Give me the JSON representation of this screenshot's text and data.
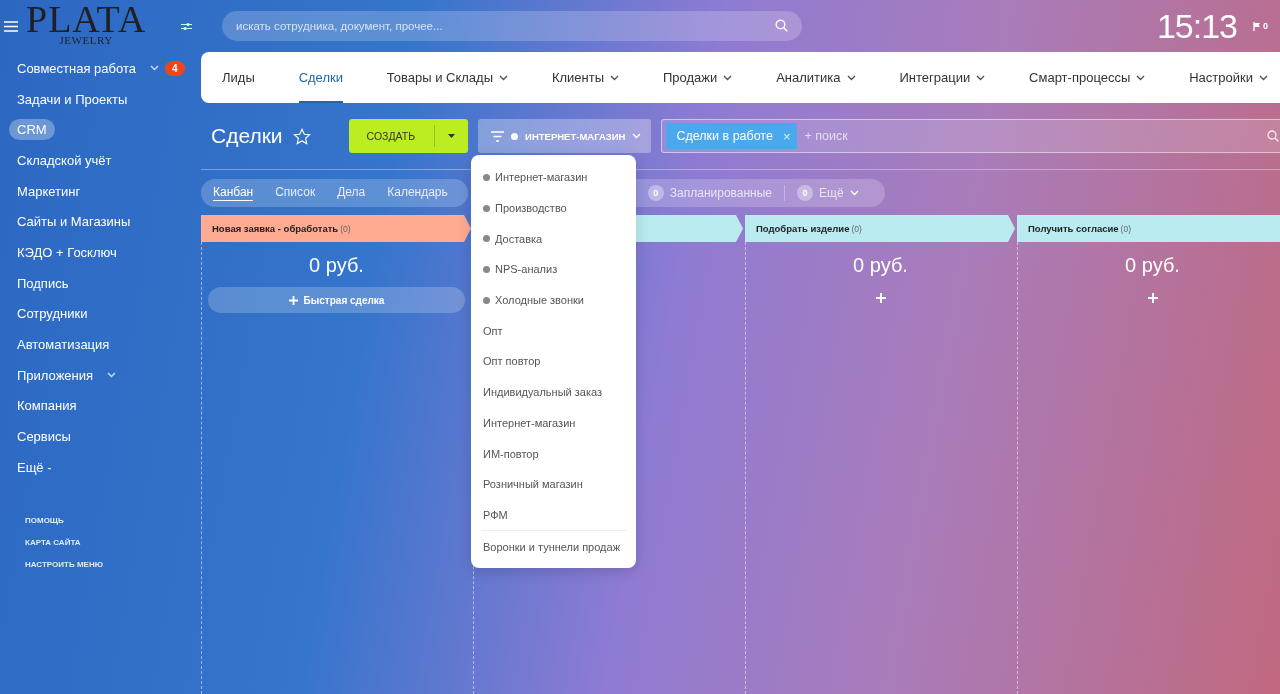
{
  "sidebar": {
    "logo": {
      "title": "PLATA",
      "subtitle": "JEWELRY"
    },
    "items": [
      {
        "label": "Совместная работа",
        "expandable": true,
        "badge": "4",
        "selected": false
      },
      {
        "label": "Задачи и Проекты",
        "expandable": false,
        "selected": false
      },
      {
        "label": "CRM",
        "expandable": false,
        "selected": true
      },
      {
        "label": "Складской учёт",
        "expandable": false,
        "selected": false
      },
      {
        "label": "Маркетинг",
        "expandable": false,
        "selected": false
      },
      {
        "label": "Сайты и Магазины",
        "expandable": false,
        "selected": false
      },
      {
        "label": "КЭДО + Госключ",
        "expandable": false,
        "selected": false
      },
      {
        "label": "Подпись",
        "expandable": false,
        "selected": false
      },
      {
        "label": "Сотрудники",
        "expandable": false,
        "selected": false
      },
      {
        "label": "Автоматизация",
        "expandable": false,
        "selected": false
      },
      {
        "label": "Приложения",
        "expandable": true,
        "selected": false
      },
      {
        "label": "Компания",
        "expandable": false,
        "selected": false
      },
      {
        "label": "Сервисы",
        "expandable": false,
        "selected": false
      },
      {
        "label": "Ещё -",
        "expandable": false,
        "selected": false
      }
    ],
    "footer_links": [
      "ПОМОЩЬ",
      "КАРТА САЙТА",
      "НАСТРОИТЬ МЕНЮ"
    ]
  },
  "header": {
    "search": {
      "placeholder": "искать сотрудника, документ, прочее..."
    },
    "clock": "15:13",
    "notifications": "0"
  },
  "nav": {
    "tabs": [
      {
        "label": "Лиды",
        "dropdown": false,
        "selected": false
      },
      {
        "label": "Сделки",
        "dropdown": false,
        "selected": true
      },
      {
        "label": "Товары и Склады",
        "dropdown": true,
        "selected": false
      },
      {
        "label": "Клиенты",
        "dropdown": true,
        "selected": false
      },
      {
        "label": "Продажи",
        "dropdown": true,
        "selected": false
      },
      {
        "label": "Аналитика",
        "dropdown": true,
        "selected": false
      },
      {
        "label": "Интеграции",
        "dropdown": true,
        "selected": false
      },
      {
        "label": "Смарт-процессы",
        "dropdown": true,
        "selected": false
      },
      {
        "label": "Настройки",
        "dropdown": true,
        "selected": false
      }
    ]
  },
  "toolbar": {
    "title": "Сделки",
    "create_button": "СОЗДАТЬ",
    "funnel_button": "ИНТЕРНЕТ-МАГАЗИН",
    "filter": {
      "tags": [
        {
          "label": "Сделки в работе",
          "remove": "×"
        }
      ],
      "placeholder": "+ поиск"
    }
  },
  "views": [
    {
      "label": "Канбан",
      "selected": true
    },
    {
      "label": "Список",
      "selected": false
    },
    {
      "label": "Дела",
      "selected": false
    },
    {
      "label": "Календарь",
      "selected": false
    }
  ],
  "counters": [
    {
      "count": "0",
      "label": "Запланированные",
      "dropdown": false
    },
    {
      "count": "0",
      "label": "Ещё",
      "dropdown": true
    }
  ],
  "columns": [
    {
      "title": "Новая заявка - обработать",
      "count": "(0)",
      "color": "#ffab91",
      "amount": "0 руб.",
      "quick_add_label": "Быстрая сделка",
      "add_button": false
    },
    {
      "color": "#b9ebf0",
      "add_button": false
    },
    {
      "title": "Подобрать изделие",
      "count": "(0)",
      "color": "#b9ebf0",
      "amount": "0 руб.",
      "add_button": true
    },
    {
      "title": "Получить согласие",
      "count": "(0)",
      "color": "#b9ebf0",
      "amount": "0 руб.",
      "add_button": true
    }
  ],
  "funnel_menu": {
    "items": [
      {
        "label": "Интернет-магазин",
        "dot": true
      },
      {
        "label": "Производство",
        "dot": true
      },
      {
        "label": "Доставка",
        "dot": true
      },
      {
        "label": "NPS-анализ",
        "dot": true
      },
      {
        "label": "Холодные звонки",
        "dot": true
      },
      {
        "label": "Опт",
        "dot": false
      },
      {
        "label": "Опт повтор",
        "dot": false
      },
      {
        "label": "Индивидуальный заказ",
        "dot": false
      },
      {
        "label": "Интернет-магазин",
        "dot": false
      },
      {
        "label": "ИМ-повтор",
        "dot": false
      },
      {
        "label": "Розничный магазин",
        "dot": false
      },
      {
        "label": "РФМ",
        "dot": false
      }
    ],
    "footer": "Воронки и туннели продаж"
  }
}
